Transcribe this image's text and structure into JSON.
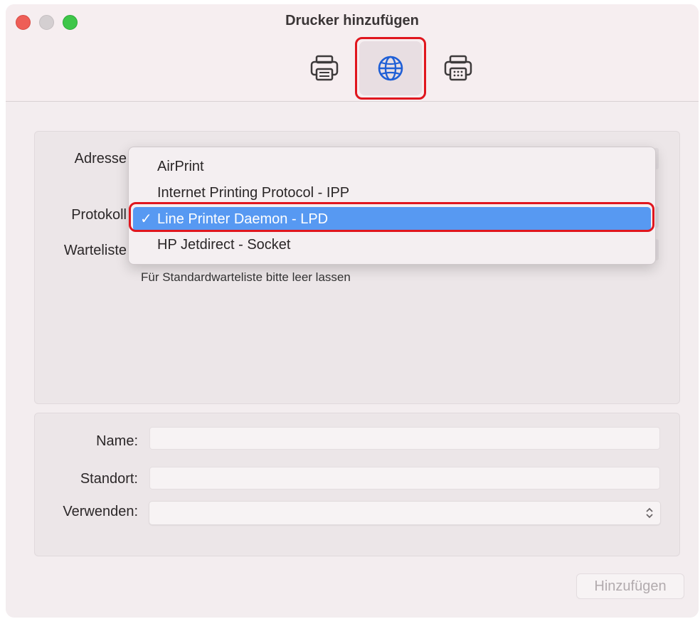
{
  "window": {
    "title": "Drucker hinzufügen"
  },
  "toolbar": {
    "items": [
      {
        "name": "default-printer",
        "icon": "printer-icon"
      },
      {
        "name": "ip-printer",
        "icon": "globe-icon",
        "selected": true
      },
      {
        "name": "windows-printer",
        "icon": "fax-printer-icon"
      }
    ]
  },
  "form": {
    "address_label": "Adresse",
    "protocol_label": "Protokoll",
    "queue_label": "Warteliste",
    "queue_hint": "Für Standardwarteliste bitte leer lassen"
  },
  "protocol_menu": {
    "options": [
      {
        "label": "AirPrint"
      },
      {
        "label": "Internet Printing Protocol - IPP"
      },
      {
        "label": "Line Printer Daemon - LPD",
        "selected": true
      },
      {
        "label": "HP Jetdirect - Socket"
      }
    ],
    "check_mark": "✓"
  },
  "details": {
    "name_label": "Name:",
    "name_value": "",
    "location_label": "Standort:",
    "location_value": "",
    "use_label": "Verwenden:",
    "use_value": ""
  },
  "actions": {
    "add_label": "Hinzufügen"
  },
  "colors": {
    "selection": "#5799f2",
    "highlight_border": "#e0161e",
    "globe_icon": "#1f5fd6"
  }
}
